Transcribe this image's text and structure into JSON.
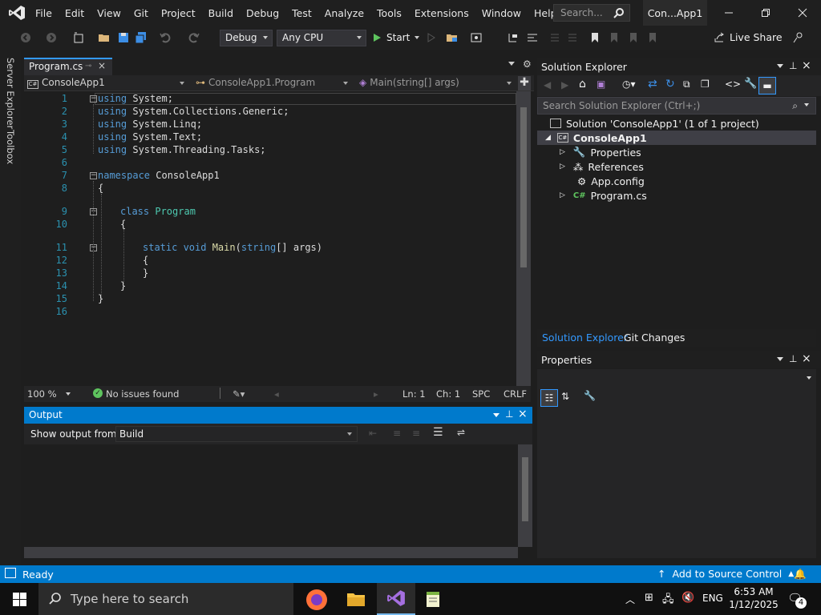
{
  "menubar": {
    "items": [
      "File",
      "Edit",
      "View",
      "Git",
      "Project",
      "Build",
      "Debug",
      "Test",
      "Analyze",
      "Tools",
      "Extensions",
      "Window",
      "Help"
    ],
    "search_placeholder": "Search...",
    "solution_title": "Con...App1"
  },
  "toolbar": {
    "configuration": "Debug",
    "platform": "Any CPU",
    "start_label": "Start",
    "live_share": "Live Share"
  },
  "left_rail": {
    "tabs": [
      "Server Explorer",
      "Toolbox"
    ]
  },
  "editor": {
    "tab_name": "Program.cs",
    "nav_project": "ConsoleApp1",
    "nav_class": "ConsoleApp1.Program",
    "nav_member": "Main(string[] args)",
    "line_numbers": [
      "1",
      "2",
      "3",
      "4",
      "5",
      "6",
      "7",
      "8",
      "9",
      "10",
      "11",
      "12",
      "13",
      "14",
      "15",
      "16"
    ],
    "lines": {
      "l1_kw": "using",
      "l1_rest": " System;",
      "l2_kw": "using",
      "l2_rest": " System.Collections.Generic;",
      "l3_kw": "using",
      "l3_rest": " System.Linq;",
      "l4_kw": "using",
      "l4_rest": " System.Text;",
      "l5_kw": "using",
      "l5_rest": " System.Threading.Tasks;",
      "l7_kw": "namespace",
      "l7_rest": " ConsoleApp1",
      "l8": "{",
      "l9_kw": "class",
      "l9_ty": " Program",
      "l10": "{",
      "l11_kw": "static void",
      "l11_mt": " Main",
      "l11_p1": "(",
      "l11_kw2": "string",
      "l11_p2": "[] args)",
      "l12": "{",
      "l13": "}",
      "l14": "}",
      "l15": "}"
    },
    "status": {
      "zoom": "100 %",
      "issues": "No issues found",
      "ln": "Ln: 1",
      "ch": "Ch: 1",
      "spc": "SPC",
      "eol": "CRLF"
    }
  },
  "output": {
    "title": "Output",
    "show_from_label": "Show output from:",
    "source": "Build"
  },
  "solution_explorer": {
    "title": "Solution Explorer",
    "search_placeholder": "Search Solution Explorer (Ctrl+;)",
    "solution_node": "Solution 'ConsoleApp1' (1 of 1 project)",
    "project_node": "ConsoleApp1",
    "children": [
      "Properties",
      "References",
      "App.config",
      "Program.cs"
    ],
    "bottom_tabs": [
      "Solution Explorer",
      "Git Changes"
    ]
  },
  "properties": {
    "title": "Properties"
  },
  "statusbar": {
    "ready": "Ready",
    "source_control": "Add to Source Control"
  },
  "taskbar": {
    "search_placeholder": "Type here to search",
    "lang": "ENG",
    "time": "6:53 AM",
    "date": "1/12/2025",
    "notifications": "4"
  }
}
